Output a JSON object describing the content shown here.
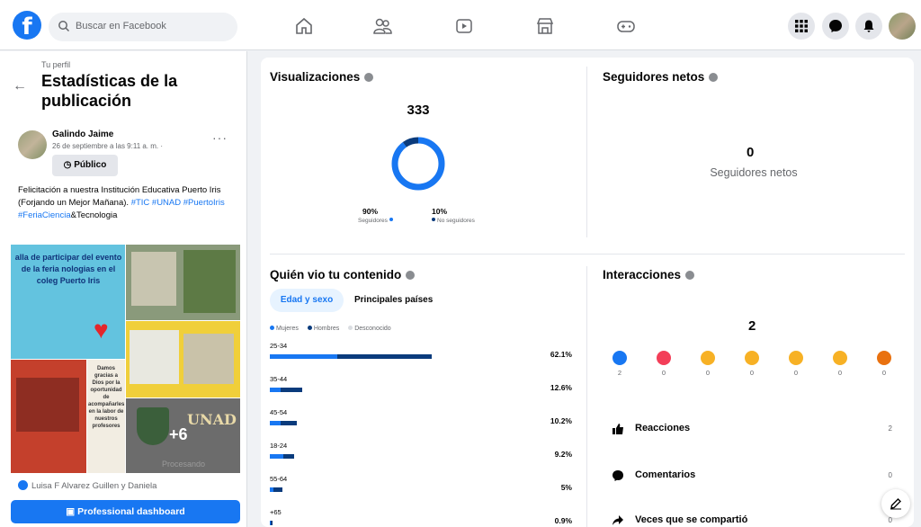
{
  "header": {
    "logo": "f",
    "search_placeholder": "Buscar en Facebook"
  },
  "left": {
    "breadcrumb": "Tu perfil",
    "title": "Estadísticas de la publicación",
    "author": "Galindo Jaime",
    "date": "26 de septiembre a las 9:11 a. m. ·",
    "audience": "Público",
    "caption_text": "Felicitación a nuestra Institución Educativa Puerto Iris (Forjando un Mejor Mañana).",
    "caption_tags": "#TIC #UNAD #PuertoIris #FeriaCiencia",
    "caption_end": "&Tecnologia",
    "image_text": "alla de participar del evento de la feria nologias en el coleg Puerto Iris",
    "image_text2": "Damos gracias a Dios por la oportunidad de acompañarles en la labor de nuestros profesores",
    "image_brand": "UNAD",
    "image_more": "+6",
    "image_processing": "Procesando",
    "reactors": "Luisa F Alvarez Guillen y Daniela",
    "dashboard_button": "Professional dashboard"
  },
  "views": {
    "title": "Visualizaciones",
    "total": "333",
    "followers_pct": "90%",
    "followers_label": "Seguidores",
    "nonfollowers_pct": "10%",
    "nonfollowers_label": "No seguidores",
    "followers_fraction": 0.9
  },
  "net": {
    "title": "Seguidores netos",
    "value": "0",
    "label": "Seguidores netos"
  },
  "audience": {
    "title": "Quién vio tu contenido",
    "tab_active": "Edad y sexo",
    "tab_other": "Principales países",
    "legend": [
      "Mujeres",
      "Hombres",
      "Desconocido"
    ],
    "rows": [
      {
        "age": "25-34",
        "pct": "62.1%",
        "women": 26.0,
        "men": 36.1
      },
      {
        "age": "35-44",
        "pct": "12.6%",
        "women": 4.0,
        "men": 8.6
      },
      {
        "age": "45-54",
        "pct": "10.2%",
        "women": 4.0,
        "men": 6.2
      },
      {
        "age": "18-24",
        "pct": "9.2%",
        "women": 5.0,
        "men": 4.2
      },
      {
        "age": "55-64",
        "pct": "5%",
        "women": 1.5,
        "men": 3.5
      },
      {
        "age": "+65",
        "pct": "0.9%",
        "women": 0.3,
        "men": 0.6
      }
    ]
  },
  "interactions": {
    "title": "Interacciones",
    "total": "2",
    "reactions": [
      {
        "icon": "like-icon",
        "count": "2",
        "color": "#1877f2"
      },
      {
        "icon": "love-icon",
        "count": "0",
        "color": "#f33e58"
      },
      {
        "icon": "care-icon",
        "count": "0",
        "color": "#f7b125"
      },
      {
        "icon": "haha-icon",
        "count": "0",
        "color": "#f7b125"
      },
      {
        "icon": "wow-icon",
        "count": "0",
        "color": "#f7b125"
      },
      {
        "icon": "sad-icon",
        "count": "0",
        "color": "#f7b125"
      },
      {
        "icon": "angry-icon",
        "count": "0",
        "color": "#e9710f"
      }
    ],
    "rows": [
      {
        "label": "Reacciones",
        "value": "2"
      },
      {
        "label": "Comentarios",
        "value": "0"
      },
      {
        "label": "Veces que se compartió",
        "value": "0"
      }
    ]
  },
  "colors": {
    "brand": "#1877f2",
    "men": "#0a3b7c"
  }
}
